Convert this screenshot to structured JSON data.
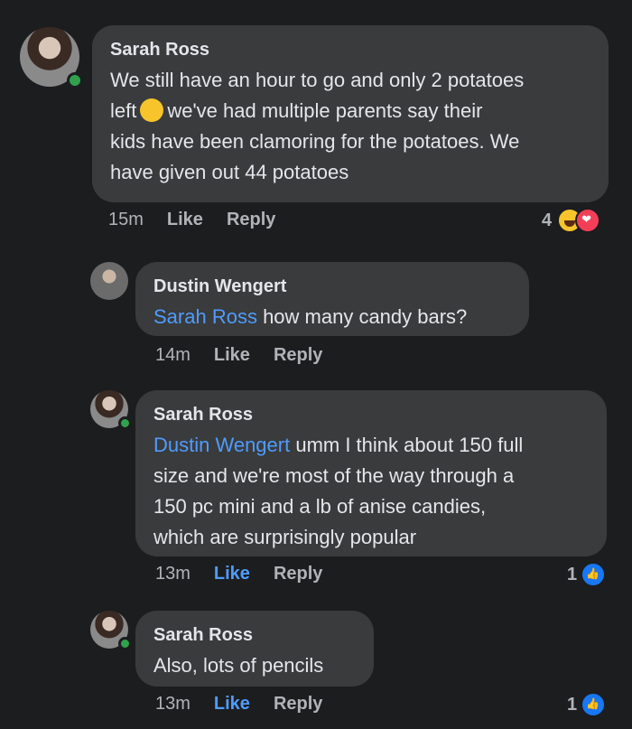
{
  "comments": [
    {
      "author": "Sarah Ross",
      "lines": [
        "We still have an hour to go and only 2 potatoes",
        "left",
        "we've had multiple parents say their",
        "kids have been clamoring for the potatoes. We",
        "have given out 44 potatoes"
      ],
      "time": "15m",
      "like": "Like",
      "reply": "Reply",
      "reaction_count": "4"
    },
    {
      "author": "Dustin Wengert",
      "mention": "Sarah Ross",
      "text": " how many candy bars?",
      "time": "14m",
      "like": "Like",
      "reply": "Reply"
    },
    {
      "author": "Sarah Ross",
      "mention": "Dustin Wengert",
      "lines": [
        " umm I think about 150 full",
        "size and we're most of the way through a",
        "150 pc mini and a lb of anise candies,",
        "which are surprisingly popular"
      ],
      "time": "13m",
      "like": "Like",
      "reply": "Reply",
      "reaction_count": "1"
    },
    {
      "author": "Sarah Ross",
      "text": "Also, lots of pencils",
      "time": "13m",
      "like": "Like",
      "reply": "Reply",
      "reaction_count": "1"
    }
  ],
  "colors": {
    "background": "#1c1d1f",
    "bubble": "#3a3b3c",
    "link": "#4e9cff",
    "online": "#31a24c"
  },
  "icons": {
    "reaction_1": "haha-emoji",
    "reaction_1b": "heart-emoji",
    "reaction_like": "thumbs-up-emoji"
  }
}
